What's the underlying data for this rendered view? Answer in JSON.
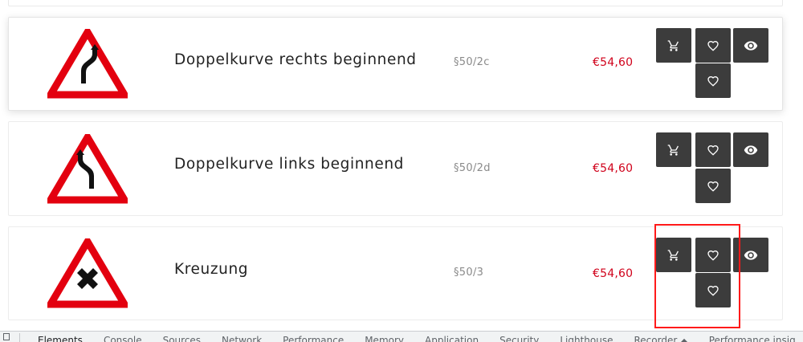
{
  "products": [
    {
      "name": "Doppelkurve rechts beginnend",
      "code": "§50/2c",
      "price": "€54,60",
      "sign_icon": "double-curve-right-sign-icon"
    },
    {
      "name": "Doppelkurve links beginnend",
      "code": "§50/2d",
      "price": "€54,60",
      "sign_icon": "double-curve-left-sign-icon"
    },
    {
      "name": "Kreuzung",
      "code": "§50/3",
      "price": "€54,60",
      "sign_icon": "crossroads-sign-icon"
    }
  ],
  "actions": {
    "cart_icon": "cart-icon",
    "wishlist_icon": "heart-icon",
    "compare_icon": "heart-icon",
    "quickview_icon": "eye-icon"
  },
  "colors": {
    "sign_red": "#e3000f",
    "price_red": "#d0021b",
    "button_bg": "#3c3c3c",
    "highlight": "#ff1a1a"
  },
  "devtools": {
    "tabs": [
      "Elements",
      "Console",
      "Sources",
      "Network",
      "Performance",
      "Memory",
      "Application",
      "Security",
      "Lighthouse",
      "Recorder ⏶",
      "Performance insig"
    ]
  }
}
